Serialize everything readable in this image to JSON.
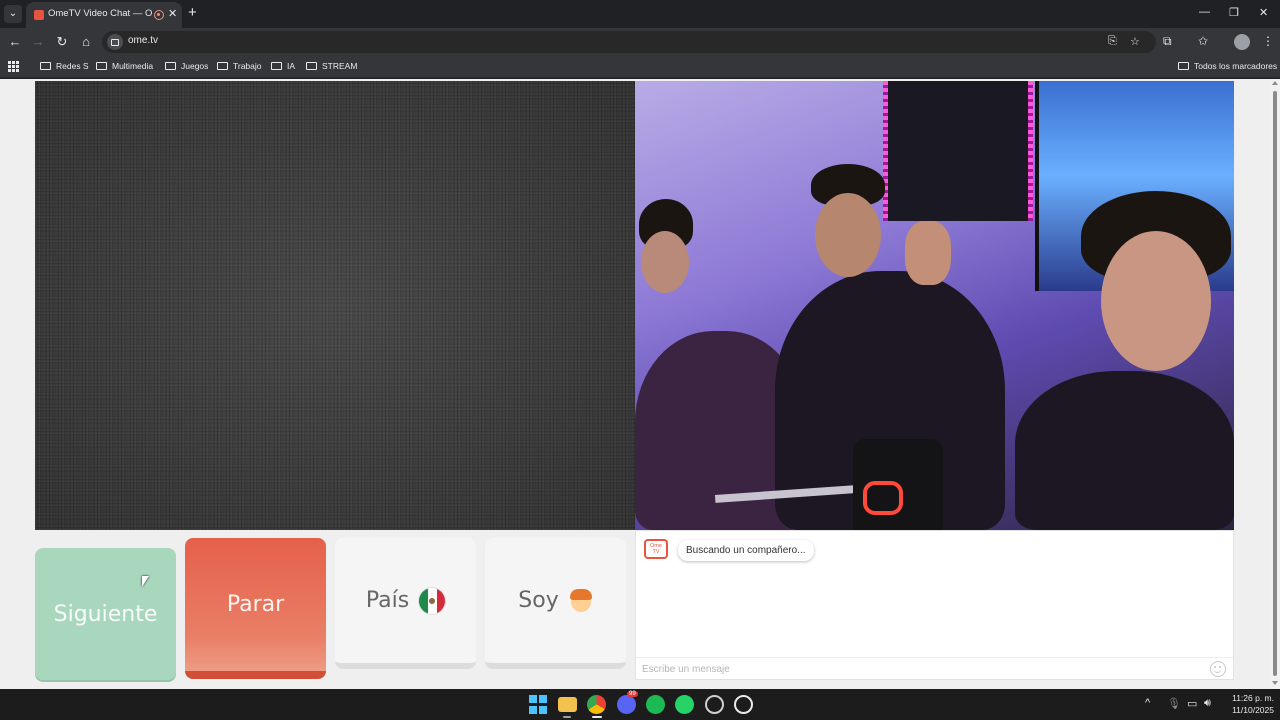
{
  "browser": {
    "tab": {
      "title": "OmeTV Video Chat — Ome"
    },
    "url": "ome.tv",
    "bookmarks": [
      "Redes S",
      "Multimedia",
      "Juegos",
      "Trabajo",
      "IA",
      "STREAM"
    ],
    "all_bookmarks_label": "Todos los marcadores"
  },
  "controls": {
    "next_label": "Siguiente",
    "stop_label": "Parar",
    "country_label": "País",
    "country_flag": "mexico-flag",
    "gender_label": "Soy",
    "gender_icon": "boy-avatar"
  },
  "chat": {
    "logo_text": "Ome TV",
    "status_message": "Buscando un compañero...",
    "input_placeholder": "Escribe un mensaje"
  },
  "taskbar": {
    "time": "11:26 p. m.",
    "date": "11/10/2025",
    "discord_badge": "99"
  },
  "colors": {
    "next_button": "#a8d7be",
    "stop_button": "#e5604a",
    "brand": "#e8543f"
  }
}
